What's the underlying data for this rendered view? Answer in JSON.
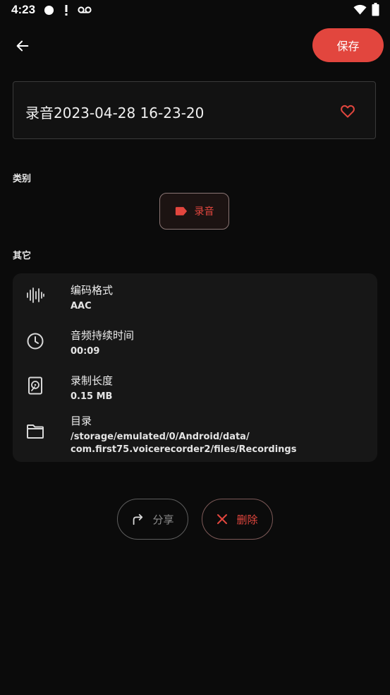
{
  "status_bar": {
    "time": "4:23",
    "icons": [
      "circle-icon",
      "alert-icon",
      "voicemail-icon",
      "wifi-icon",
      "battery-icon"
    ]
  },
  "header": {
    "back_icon": "arrow-left-icon",
    "save_label": "保存"
  },
  "recording": {
    "title": "录音2023-04-28 16-23-20",
    "favorite_icon": "heart-outline-icon"
  },
  "category": {
    "section_label": "类别",
    "chip_label": "录音",
    "chip_icon": "label-tag-icon"
  },
  "other": {
    "section_label": "其它",
    "rows": [
      {
        "icon": "waveform-icon",
        "title": "编码格式",
        "value": "AAC"
      },
      {
        "icon": "clock-icon",
        "title": "音频持续时间",
        "value": "00:09"
      },
      {
        "icon": "storage-icon",
        "title": "录制长度",
        "value": "0.15 MB"
      },
      {
        "icon": "folder-icon",
        "title": "目录",
        "value_line1": "/storage/emulated/0/Android/data/",
        "value_line2": "com.first75.voicerecorder2/files/Recordings"
      }
    ]
  },
  "actions": {
    "share_label": "分享",
    "delete_label": "删除"
  },
  "colors": {
    "accent": "#e2463e",
    "background": "#0b0b0b",
    "card": "#171717"
  }
}
